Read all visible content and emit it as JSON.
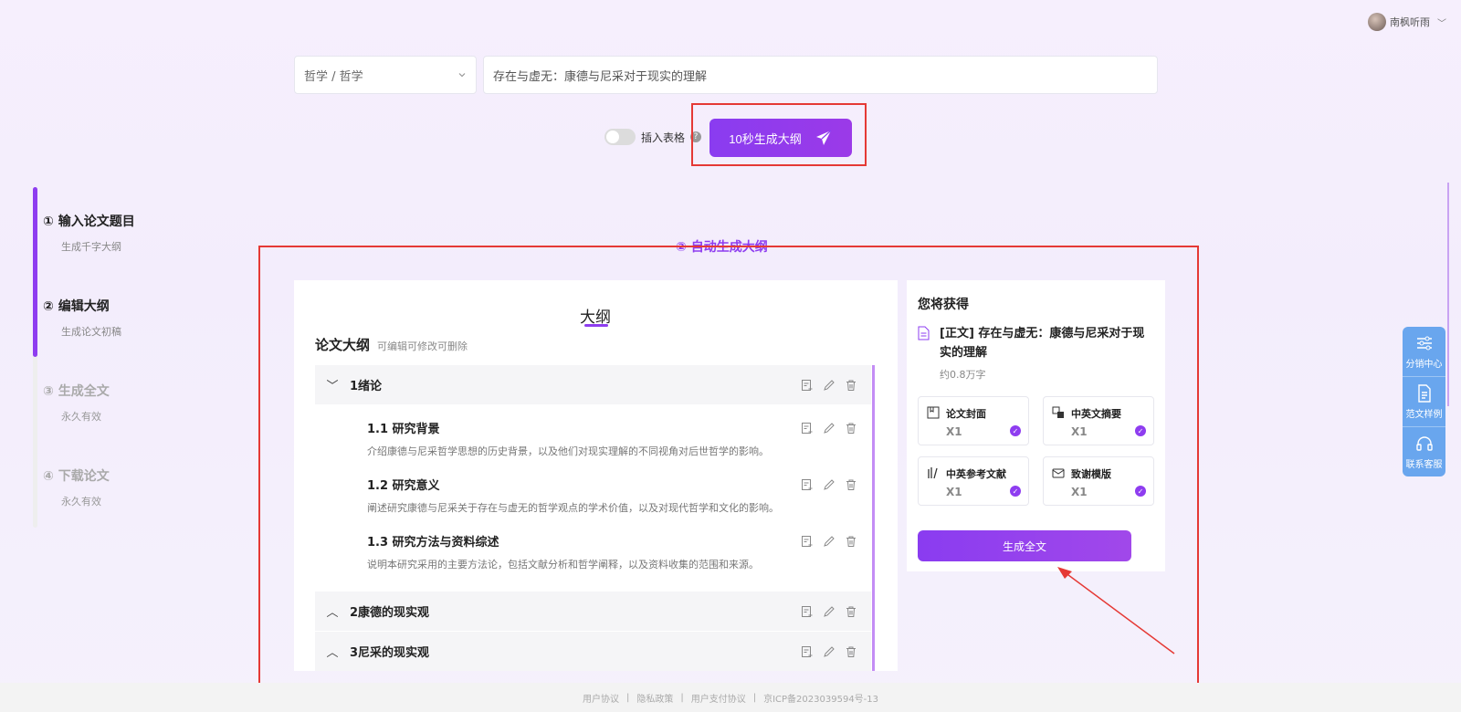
{
  "user": {
    "name": "南枫听雨",
    "chevron": "﹀"
  },
  "search": {
    "subject": "哲学 / 哲学",
    "topic": "存在与虚无：康德与尼采对于现实的理解"
  },
  "options": {
    "insert_table_label": "插入表格",
    "help": "?"
  },
  "generate_outline_button": "10秒生成大纲",
  "steps": [
    {
      "num": "① 输入论文题目",
      "sub": "生成千字大纲"
    },
    {
      "num": "② 编辑大纲",
      "sub": "生成论文初稿"
    },
    {
      "num": "③ 生成全文",
      "sub": "永久有效"
    },
    {
      "num": "④ 下载论文",
      "sub": "永久有效"
    }
  ],
  "section_heading": "② 自动生成大纲",
  "outline": {
    "title": "大纲",
    "heading": "论文大纲",
    "hint": "可编辑可修改可删除",
    "chapters": [
      {
        "caret": "﹀",
        "label": "1绪论"
      },
      {
        "caret": "︿",
        "label": "2康德的现实观"
      },
      {
        "caret": "︿",
        "label": "3尼采的现实观"
      }
    ],
    "sections": [
      {
        "title": "1.1 研究背景",
        "desc": "介绍康德与尼采哲学思想的历史背景，以及他们对现实理解的不同视角对后世哲学的影响。"
      },
      {
        "title": "1.2 研究意义",
        "desc": "阐述研究康德与尼采关于存在与虚无的哲学观点的学术价值，以及对现代哲学和文化的影响。"
      },
      {
        "title": "1.3 研究方法与资料综述",
        "desc": "说明本研究采用的主要方法论，包括文献分析和哲学阐释，以及资料收集的范围和来源。"
      }
    ]
  },
  "get_panel": {
    "title": "您将获得",
    "doc": "[正文] 存在与虚无：康德与尼采对于现实的理解",
    "words": "约0.8万字",
    "cards": [
      {
        "label": "论文封面",
        "count": "X1"
      },
      {
        "label": "中英文摘要",
        "count": "X1"
      },
      {
        "label": "中英参考文献",
        "count": "X1"
      },
      {
        "label": "致谢模版",
        "count": "X1"
      }
    ],
    "button": "生成全文"
  },
  "float_menu": [
    {
      "label": "分销中心",
      "icon": "sliders-icon"
    },
    {
      "label": "范文样例",
      "icon": "document-icon"
    },
    {
      "label": "联系客服",
      "icon": "headset-icon"
    }
  ],
  "footer": [
    "用户协议",
    "|",
    "隐私政策",
    "|",
    "用户支付协议",
    "|",
    "京ICP备2023039594号-13"
  ],
  "colors": {
    "accent": "#8e3df0",
    "annotation_red": "#e53935",
    "float_blue": "#69a6ee"
  }
}
